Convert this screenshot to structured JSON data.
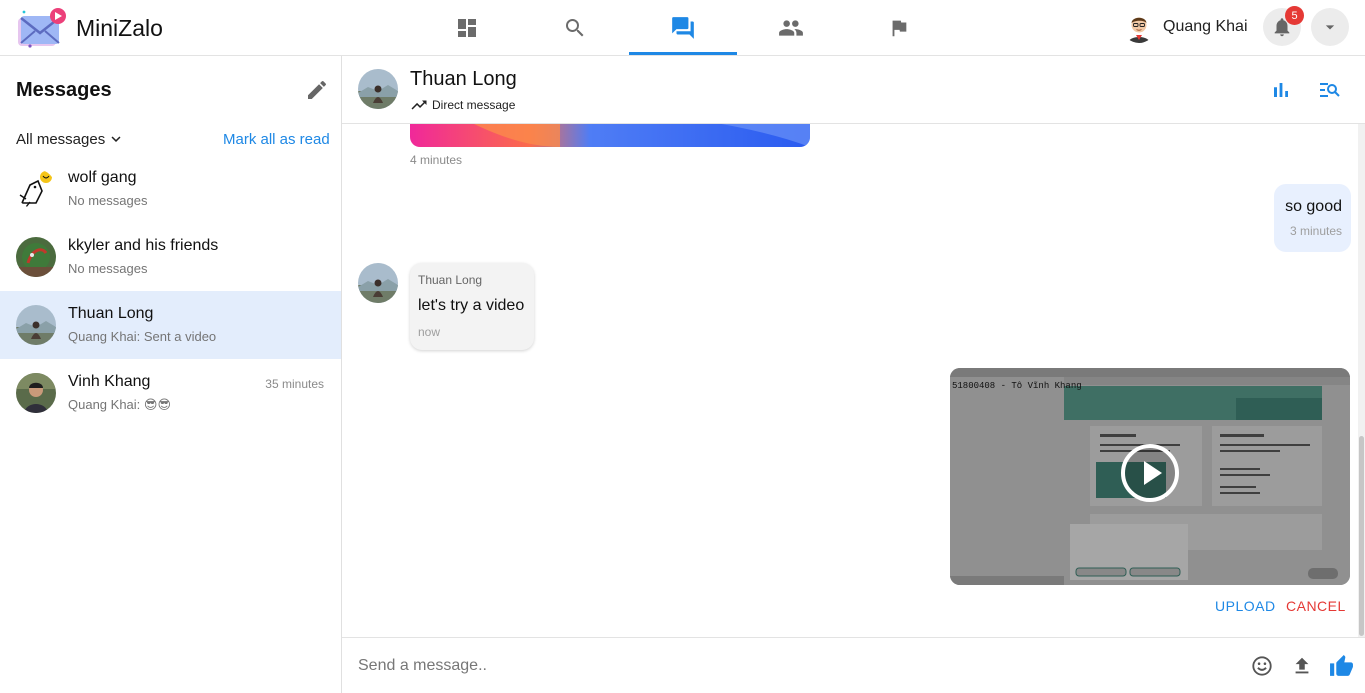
{
  "app": {
    "name": "MiniZalo"
  },
  "nav": {
    "tabs": [
      {
        "icon": "dashboard-icon"
      },
      {
        "icon": "search-icon"
      },
      {
        "icon": "forum-icon",
        "active": true
      },
      {
        "icon": "people-icon"
      },
      {
        "icon": "flag-icon"
      }
    ]
  },
  "user": {
    "name": "Quang Khai",
    "notifications": "5"
  },
  "sidebar": {
    "title": "Messages",
    "filter": "All messages",
    "mark_all_read": "Mark all as read",
    "conversations": [
      {
        "name": "wolf gang",
        "preview": "No messages",
        "time": ""
      },
      {
        "name": "kkyler and his friends",
        "preview": "No messages",
        "time": ""
      },
      {
        "name": "Thuan Long",
        "preview": "Quang Khai: Sent a video",
        "time": "",
        "selected": true
      },
      {
        "name": "Vinh Khang",
        "preview": "Quang Khai: 😎😎",
        "time": "35 minutes"
      }
    ]
  },
  "chat": {
    "title": "Thuan Long",
    "subtitle": "Direct message",
    "messages": [
      {
        "type": "image",
        "time": "4 minutes"
      },
      {
        "type": "text",
        "own": true,
        "text": "so good",
        "time": "3 minutes"
      },
      {
        "type": "text",
        "own": false,
        "sender": "Thuan Long",
        "text": "let's try a video",
        "time": "now"
      }
    ],
    "pending_video": {
      "caption": "51800408 - Tô Vĩnh Khang",
      "upload_label": "UPLOAD",
      "cancel_label": "CANCEL"
    }
  },
  "composer": {
    "placeholder": "Send a message.."
  },
  "colors": {
    "accent": "#1e88e5",
    "danger": "#e53935",
    "selected_bg": "#e3edfc",
    "own_bubble": "#e8f0fe"
  }
}
